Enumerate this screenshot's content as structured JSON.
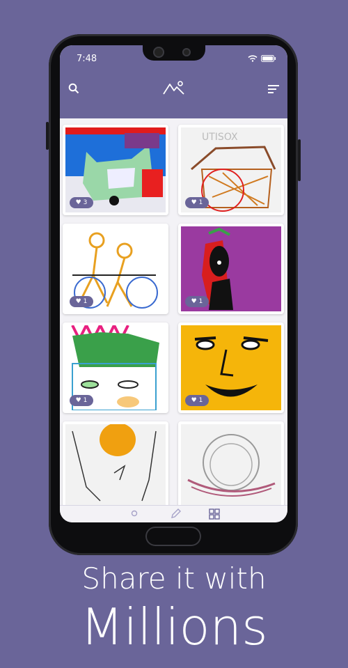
{
  "status": {
    "time": "7:48"
  },
  "header": {
    "search_icon": "search-icon",
    "logo_icon": "mountain-logo-icon",
    "sort_icon": "sort-icon"
  },
  "gallery": {
    "items": [
      {
        "likes": "3"
      },
      {
        "likes": "1"
      },
      {
        "likes": "1"
      },
      {
        "likes": "1"
      },
      {
        "likes": "1"
      },
      {
        "likes": "1"
      },
      {
        "likes": ""
      },
      {
        "likes": ""
      }
    ]
  },
  "bottom_nav": {
    "items": [
      "profile-icon",
      "pencil-icon",
      "grid-icon"
    ]
  },
  "tagline": {
    "line1": "Share it with",
    "line2": "Millions"
  },
  "colors": {
    "brand": "#6a6599",
    "screen_bg": "#f3f2f6"
  }
}
